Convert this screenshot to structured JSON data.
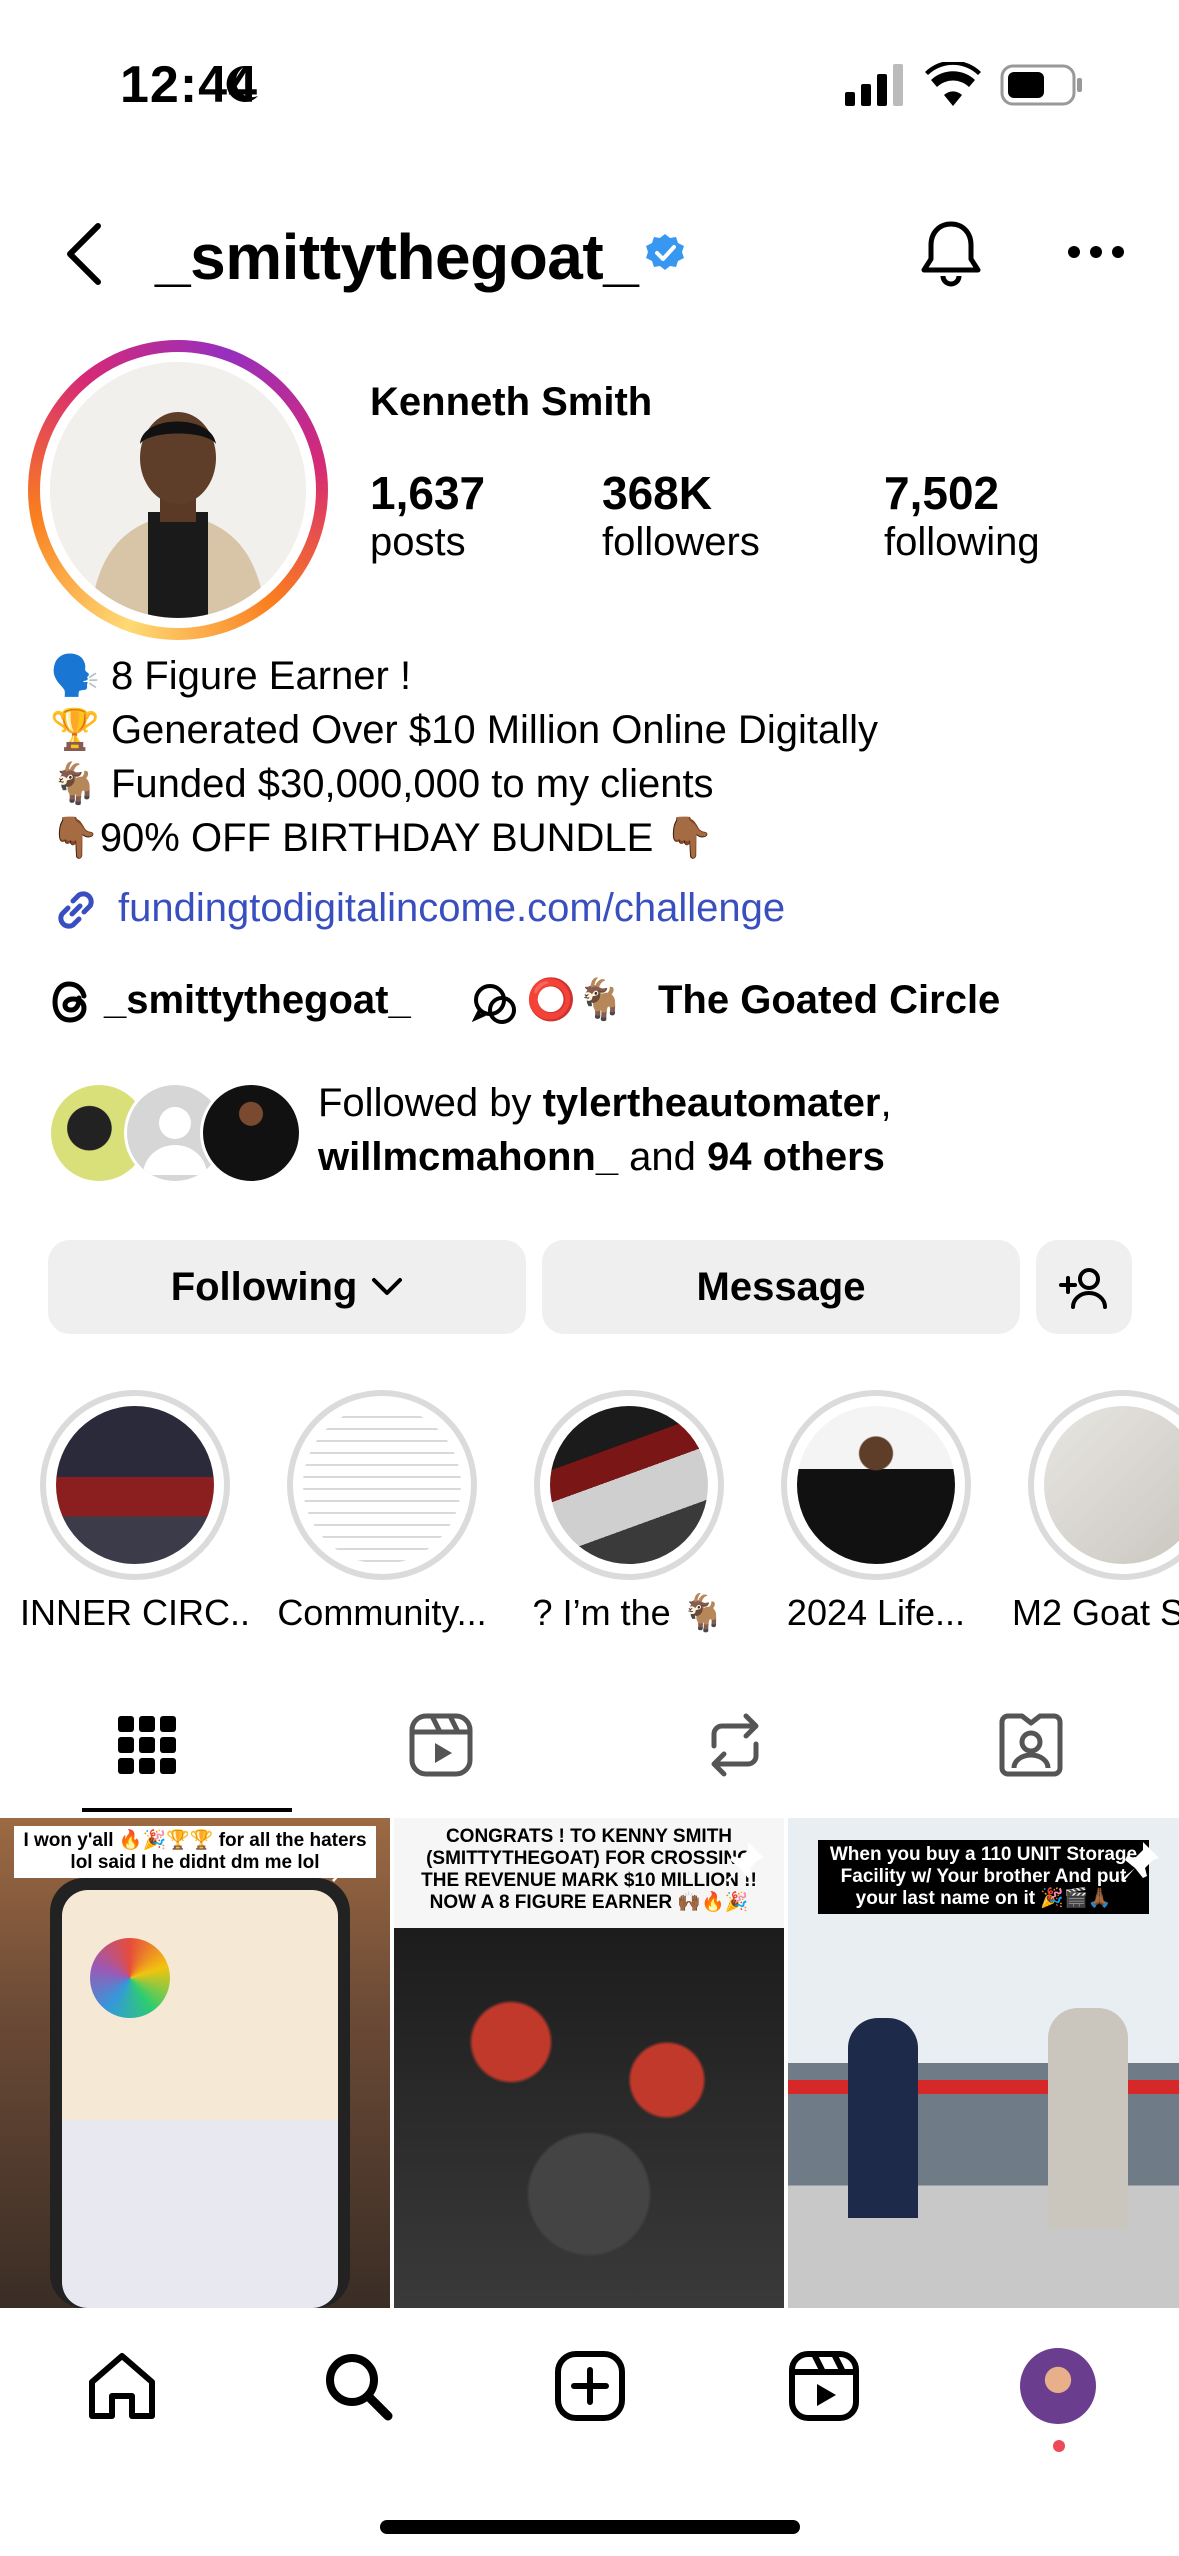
{
  "status_bar": {
    "time": "12:44"
  },
  "header": {
    "username": "_smittythegoat_",
    "verified": true
  },
  "profile": {
    "display_name": "Kenneth Smith",
    "stats": [
      {
        "value": "1,637",
        "label": "posts"
      },
      {
        "value": "368K",
        "label": "followers"
      },
      {
        "value": "7,502",
        "label": "following"
      }
    ],
    "bio": [
      {
        "emoji": "🗣️",
        "text": "8 Figure Earner !"
      },
      {
        "emoji": "🏆",
        "text": "Generated Over $10 Million Online Digitally"
      },
      {
        "emoji": "🐐",
        "text": "Funded $30,000,000 to my clients"
      },
      {
        "emoji": "👇🏾",
        "text": "90% OFF BIRTHDAY BUNDLE",
        "emoji_after": "👇🏾"
      }
    ],
    "link": "fundingtodigitalincome.com/challenge",
    "threads_handle": "_smittythegoat_",
    "community_emoji": "⭕🐐",
    "community_name": "The Goated Circle",
    "followed_by": {
      "prefix": "Followed by ",
      "name1": "tylertheautomater",
      "sep": ",",
      "name2": "willmcmahonn_",
      "mid": " and ",
      "others": "94 others"
    }
  },
  "actions": {
    "following": "Following",
    "message": "Message"
  },
  "highlights": [
    {
      "label": "INNER CIRC..."
    },
    {
      "label": "Community..."
    },
    {
      "label": "? I’m the 🐐"
    },
    {
      "label": "2024 Life..."
    },
    {
      "label": "M2 Goat S"
    }
  ],
  "posts": [
    {
      "caption": "I won y'all 🔥🎉🏆🏆 for all the haters lol said I he didnt dm me lol"
    },
    {
      "caption": "CONGRATS ! TO KENNY SMITH (SMITTYTHEGOAT) FOR CROSSING THE REVENUE MARK $10 MILLION !! NOW A 8 FIGURE EARNER 🙌🏾🔥🎉"
    },
    {
      "caption": "When you buy a 110 UNIT Storage Facility w/ Your brother And put your last name on it 🎉🎬🙏🏾"
    }
  ],
  "colors": {
    "link": "#3a4fbf",
    "verified": "#3897f0",
    "button_bg": "#efefef",
    "notification_dot": "#ed4956"
  }
}
